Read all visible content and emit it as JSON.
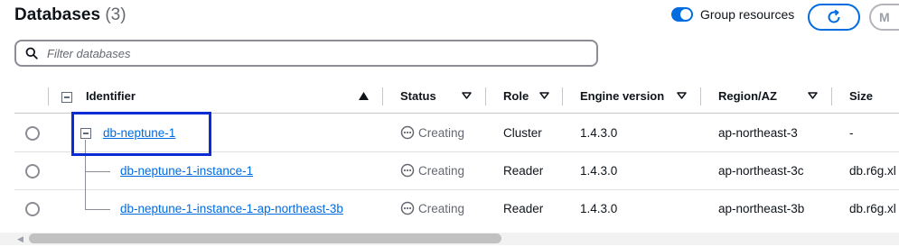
{
  "header": {
    "title": "Databases",
    "count": "(3)",
    "group_resources_label": "Group resources",
    "group_resources_on": true,
    "more_label": "M"
  },
  "search": {
    "placeholder": "Filter databases",
    "value": ""
  },
  "columns": [
    {
      "label": "Identifier",
      "sort": "ascending"
    },
    {
      "label": "Status",
      "sort": "none"
    },
    {
      "label": "Role",
      "sort": "none"
    },
    {
      "label": "Engine version",
      "sort": "none"
    },
    {
      "label": "Region/AZ",
      "sort": "none"
    },
    {
      "label": "Size",
      "sort": "none"
    }
  ],
  "rows": [
    {
      "identifier": "db-neptune-1",
      "status": "Creating",
      "role": "Cluster",
      "engine": "1.4.3.0",
      "region": "ap-northeast-3",
      "size": "-"
    },
    {
      "identifier": "db-neptune-1-instance-1",
      "status": "Creating",
      "role": "Reader",
      "engine": "1.4.3.0",
      "region": "ap-northeast-3c",
      "size": "db.r6g.xl"
    },
    {
      "identifier": "db-neptune-1-instance-1-ap-northeast-3b",
      "status": "Creating",
      "role": "Reader",
      "engine": "1.4.3.0",
      "region": "ap-northeast-3b",
      "size": "db.r6g.xl"
    }
  ],
  "colors": {
    "accent": "#006ce0",
    "highlight": "#0b2bd6",
    "status_text": "#656871"
  }
}
